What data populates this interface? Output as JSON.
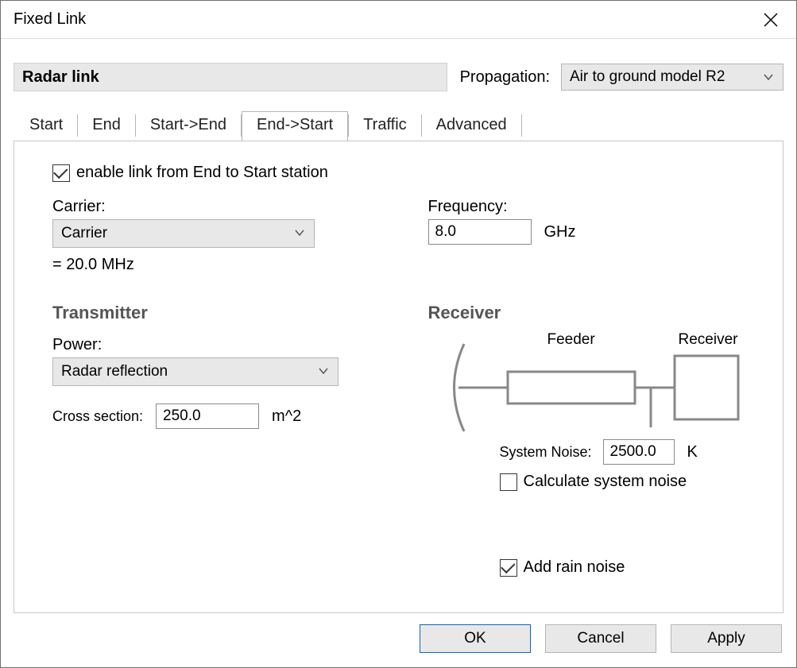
{
  "window": {
    "title": "Fixed Link"
  },
  "header": {
    "link_name": "Radar link",
    "propagation_label": "Propagation:",
    "propagation_value": "Air to ground model R2"
  },
  "tabs": {
    "items": [
      "Start",
      "End",
      "Start->End",
      "End->Start",
      "Traffic",
      "Advanced"
    ],
    "active_index": 3
  },
  "panel": {
    "enable_checkbox": {
      "label": "enable link from End to Start station",
      "checked": true
    },
    "carrier": {
      "label": "Carrier:",
      "value": "Carrier",
      "eq_line": "= 20.0 MHz"
    },
    "frequency": {
      "label": "Frequency:",
      "value": "8.0",
      "unit": "GHz"
    },
    "transmitter": {
      "heading": "Transmitter",
      "power_label": "Power:",
      "power_value": "Radar reflection",
      "cross_section_label": "Cross section:",
      "cross_section_value": "250.0",
      "cross_section_unit": "m^2"
    },
    "receiver": {
      "heading": "Receiver",
      "feeder_label": "Feeder",
      "receiver_label": "Receiver",
      "system_noise_label": "System Noise:",
      "system_noise_value": "2500.0",
      "system_noise_unit": "K",
      "calc_noise": {
        "label": "Calculate system noise",
        "checked": false
      },
      "rain_noise": {
        "label": "Add rain noise",
        "checked": true
      }
    }
  },
  "footer": {
    "ok": "OK",
    "cancel": "Cancel",
    "apply": "Apply"
  }
}
